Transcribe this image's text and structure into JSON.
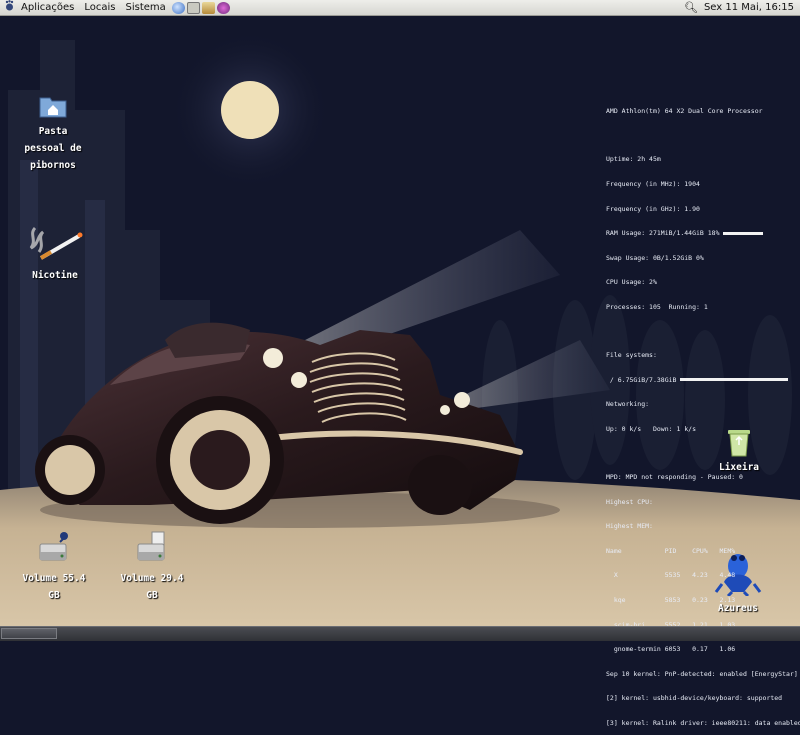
{
  "top_panel": {
    "menus": [
      "Aplicações",
      "Locais",
      "Sistema"
    ],
    "launchers": [
      "firefox-icon",
      "home-folder-icon",
      "mail-icon",
      "chat-icon"
    ],
    "clock": "Sex 11 Mai, 16:15"
  },
  "desktop_icons": {
    "home": {
      "line1": "Pasta",
      "line2": "pessoal de",
      "line3": "pibornos"
    },
    "nicotine": {
      "label": "Nicotine"
    },
    "volume1": {
      "line1": "Volume 55.4",
      "line2": "GB"
    },
    "volume2": {
      "line1": "Volume 29.4",
      "line2": "GB"
    },
    "trash": {
      "label": "Lixeira"
    },
    "azureus": {
      "label": "Azureus"
    }
  },
  "conky": {
    "cpu_line": "AMD Athlon(tm) 64 X2 Dual Core Processor",
    "stats": [
      "Uptime: 2h 45m",
      "Frequency (in MHz): 1904",
      "Frequency (in GHz): 1.90",
      "RAM Usage: 271MiB/1.44GiB",
      "Swap Usage: 0B/1.52GiB",
      "CPU Usage: 2%",
      "Processes: 105  Running: 1"
    ],
    "ram_percent_label": "18%",
    "ram_fraction": 0.18,
    "swap_percent_label": "0%",
    "fs_title": "File systems:",
    "fs_line": "/ 6.75GiB/7.38GiB",
    "fs_fraction": 0.91,
    "net_title": "Networking:",
    "net_line": "Up: 0 k/s   Down: 1 k/s",
    "mpd_line": "MPD: MPD not responding - Paused: 0",
    "proc_title1": "Highest CPU:",
    "proc_title2": "Highest MEM:",
    "proc_header": "Name           PID    CPU%   MEM%",
    "procs": [
      "  X            5535   4.23   4.48",
      "  kqe          5853   0.23   2.13",
      "  scim-bri     5552   1.21   1.03",
      "  gnome-termin 6053   0.17   1.06"
    ],
    "logs": [
      "Sep 10 kernel: PnP-detected: enabled [EnergyStar]",
      "[2] kernel: usbhid-device/keyboard: supported",
      "[3] kernel: Ralink driver: ieee80211: data enabled"
    ]
  },
  "colors": {
    "sky": "#12162b",
    "moon": "#efe0b8",
    "car": "#2a1a1d",
    "ground": "#c9b596",
    "panel": "#e4e4df"
  }
}
